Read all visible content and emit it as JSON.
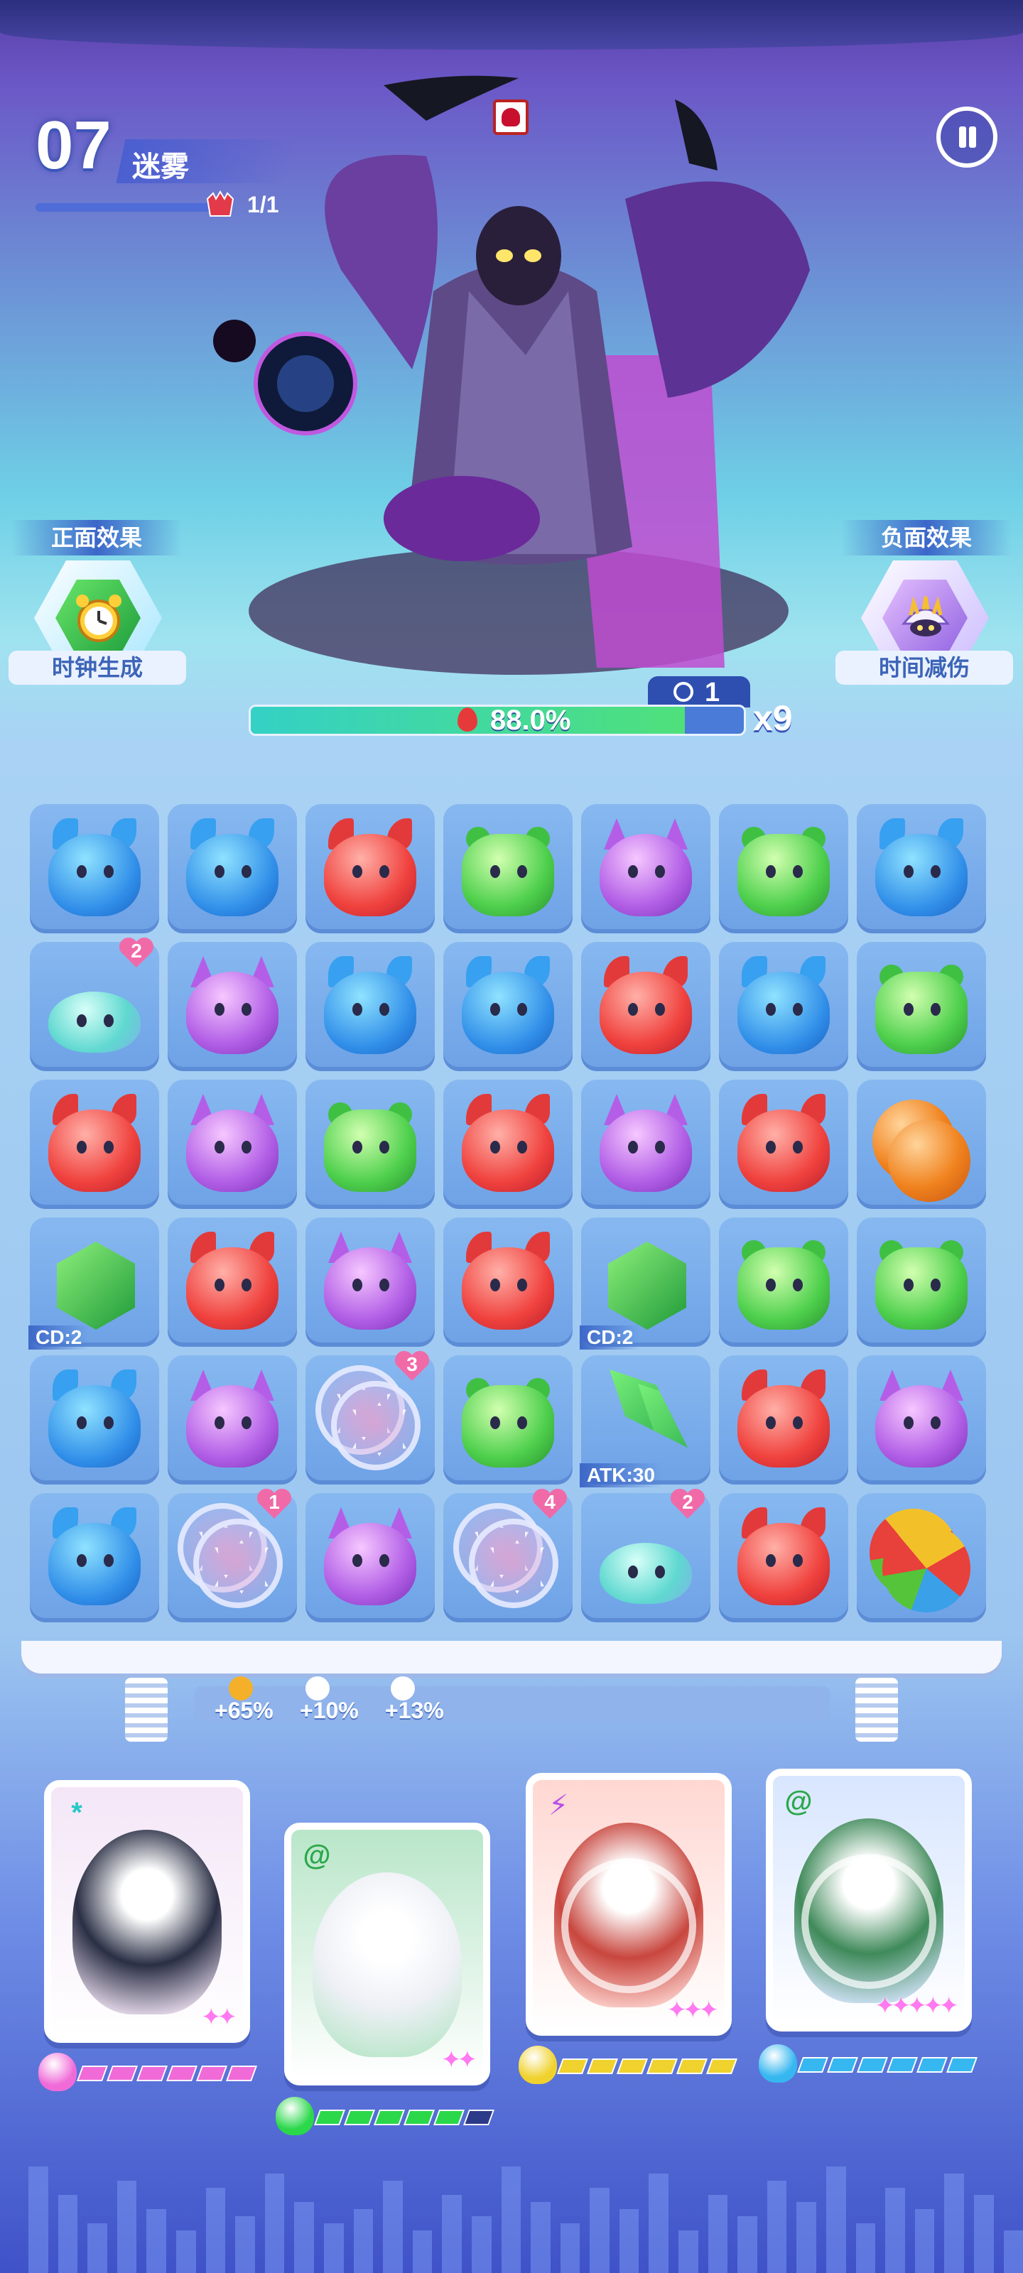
{
  "header": {
    "level_number": "07",
    "level_name": "迷雾",
    "boss_counter": "1/1"
  },
  "effects": {
    "positive": {
      "title": "正面效果",
      "label": "时钟生成",
      "icon": "alarm-clock-icon"
    },
    "negative": {
      "title": "负面效果",
      "label": "时间减伤",
      "icon": "spiked-shell-icon"
    }
  },
  "progress": {
    "percent_label": "88.0%",
    "fill_fraction": 0.88,
    "timer": "1",
    "multiplier": "x9"
  },
  "board": {
    "rows": [
      [
        {
          "t": "blue"
        },
        {
          "t": "blue"
        },
        {
          "t": "red"
        },
        {
          "t": "green"
        },
        {
          "t": "purple"
        },
        {
          "t": "green"
        },
        {
          "t": "blue"
        }
      ],
      [
        {
          "t": "teal",
          "badge": "2"
        },
        {
          "t": "purple"
        },
        {
          "t": "blue"
        },
        {
          "t": "blue"
        },
        {
          "t": "red"
        },
        {
          "t": "blue"
        },
        {
          "t": "green"
        }
      ],
      [
        {
          "t": "red"
        },
        {
          "t": "purple"
        },
        {
          "t": "green"
        },
        {
          "t": "red"
        },
        {
          "t": "purple"
        },
        {
          "t": "red"
        },
        {
          "t": "bomb"
        }
      ],
      [
        {
          "t": "leaf",
          "label": "CD:2"
        },
        {
          "t": "red"
        },
        {
          "t": "purple"
        },
        {
          "t": "red"
        },
        {
          "t": "leaf",
          "label": "CD:2"
        },
        {
          "t": "green"
        },
        {
          "t": "green"
        }
      ],
      [
        {
          "t": "blue"
        },
        {
          "t": "purple"
        },
        {
          "t": "hexagram",
          "badge": "3"
        },
        {
          "t": "green"
        },
        {
          "t": "sword",
          "label": "ATK:30"
        },
        {
          "t": "red"
        },
        {
          "t": "purple"
        }
      ],
      [
        {
          "t": "blue"
        },
        {
          "t": "hexagram",
          "badge": "1"
        },
        {
          "t": "purple"
        },
        {
          "t": "hexagram",
          "badge": "4"
        },
        {
          "t": "teal",
          "badge": "2"
        },
        {
          "t": "red"
        },
        {
          "t": "ball"
        }
      ]
    ]
  },
  "boosts": [
    "+65%",
    "+10%",
    "+13%"
  ],
  "heroes": [
    {
      "name": "robot-rabbit-hero",
      "element": "*",
      "element_color": "#27c8c8",
      "stars": "✦✦",
      "color": "purple",
      "energy_fraction": 1.0,
      "bg": "#f4e6f7",
      "art": "#2a2f45"
    },
    {
      "name": "astronaut-bear-hero",
      "element": "@",
      "element_color": "#2aa84a",
      "stars": "✦✦",
      "color": "green",
      "energy_fraction": 0.9,
      "bg": "#b9e6c9",
      "art": "#eef0f6"
    },
    {
      "name": "skull-warrior-hero",
      "element": "⚡",
      "element_color": "#b94fe8",
      "stars": "✦✦✦",
      "color": "red",
      "energy_fraction": 1.0,
      "bg": "#ffd7d2",
      "art": "#c8463e"
    },
    {
      "name": "goggle-girl-hero",
      "element": "@",
      "element_color": "#2aa84a",
      "stars": "✦✦✦✦✦",
      "color": "blue",
      "energy_fraction": 1.0,
      "bg": "#d8e6ff",
      "art": "#3f8a5a"
    }
  ],
  "colors": {
    "blue": "#37b7f0",
    "red": "#f0d22e",
    "green": "#2ad84a",
    "purple": "#f06ad8",
    "progress_fill": "#4fe07b",
    "accent": "#3b66c9"
  }
}
